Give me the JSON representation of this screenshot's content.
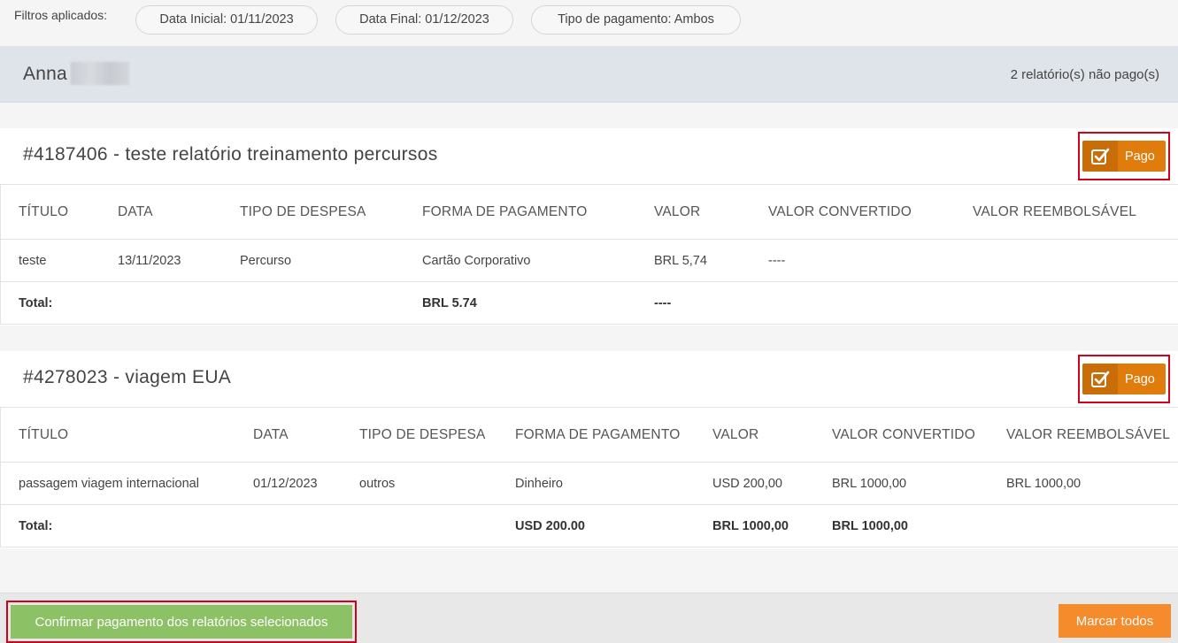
{
  "filters": {
    "label": "Filtros aplicados:",
    "chips": [
      "Data Inicial: 01/11/2023",
      "Data Final: 01/12/2023",
      "Tipo de pagamento: Ambos"
    ]
  },
  "user": {
    "name": "Anna",
    "unpaid_count": "2 relatório(s) não pago(s)"
  },
  "reports": [
    {
      "title": "#4187406 - teste relatório treinamento percursos",
      "pago_label": "Pago",
      "headers": [
        "TÍTULO",
        "DATA",
        "TIPO DE DESPESA",
        "FORMA DE PAGAMENTO",
        "VALOR",
        "VALOR CONVERTIDO",
        "VALOR REEMBOLSÁVEL"
      ],
      "rows": [
        [
          "teste",
          "13/11/2023",
          "Percurso",
          "Cartão Corporativo",
          "BRL 5,74",
          "----",
          ""
        ]
      ],
      "total": [
        "Total:",
        "",
        "",
        "BRL 5.74",
        "----",
        "",
        ""
      ]
    },
    {
      "title": "#4278023 - viagem EUA",
      "pago_label": "Pago",
      "headers": [
        "TÍTULO",
        "DATA",
        "TIPO DE DESPESA",
        "FORMA DE PAGAMENTO",
        "VALOR",
        "VALOR CONVERTIDO",
        "VALOR REEMBOLSÁVEL"
      ],
      "rows": [
        [
          "passagem viagem internacional",
          "01/12/2023",
          "outros",
          "Dinheiro",
          "USD 200,00",
          "BRL 1000,00",
          "BRL 1000,00"
        ]
      ],
      "total": [
        "Total:",
        "",
        "",
        "USD 200.00",
        "BRL 1000,00",
        "BRL 1000,00",
        ""
      ]
    }
  ],
  "actions": {
    "confirm_label": "Confirmar pagamento dos relatórios selecionados",
    "mark_all_label": "Marcar todos"
  },
  "colors": {
    "pago": "#e07c0c",
    "confirm": "#8cc265",
    "mark_all": "#f58b2a",
    "highlight": "#d0021b"
  }
}
